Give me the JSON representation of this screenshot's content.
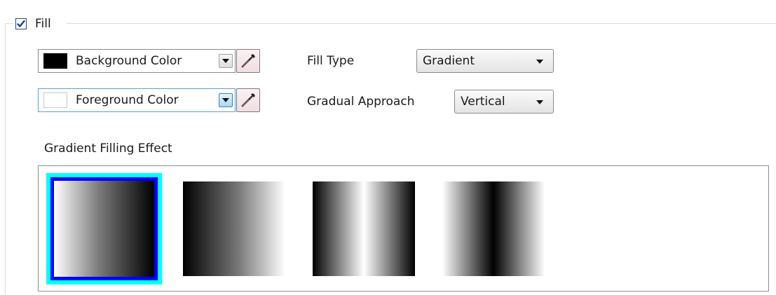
{
  "fill_section": {
    "checkbox_checked": true,
    "label": "Fill"
  },
  "background_color": {
    "label": "Background Color",
    "swatch": "#000000"
  },
  "foreground_color": {
    "label": "Foreground Color",
    "swatch": "#ffffff"
  },
  "fill_type": {
    "label": "Fill Type",
    "value": "Gradient"
  },
  "gradual_approach": {
    "label": "Gradual Approach",
    "value": "Vertical"
  },
  "effects": {
    "heading": "Gradient Filling Effect",
    "items": [
      {
        "name": "light-to-dark",
        "selected": true
      },
      {
        "name": "dark-to-light",
        "selected": false
      },
      {
        "name": "dark-light-dark",
        "selected": false
      },
      {
        "name": "light-dark-light",
        "selected": false
      }
    ]
  },
  "colors": {
    "selection_outer": "#00ffff",
    "selection_inner": "#0000ff",
    "focus_border": "#5b9fd6"
  },
  "icons": [
    "checkmark-icon",
    "chevron-down-icon",
    "eyedropper-icon"
  ]
}
